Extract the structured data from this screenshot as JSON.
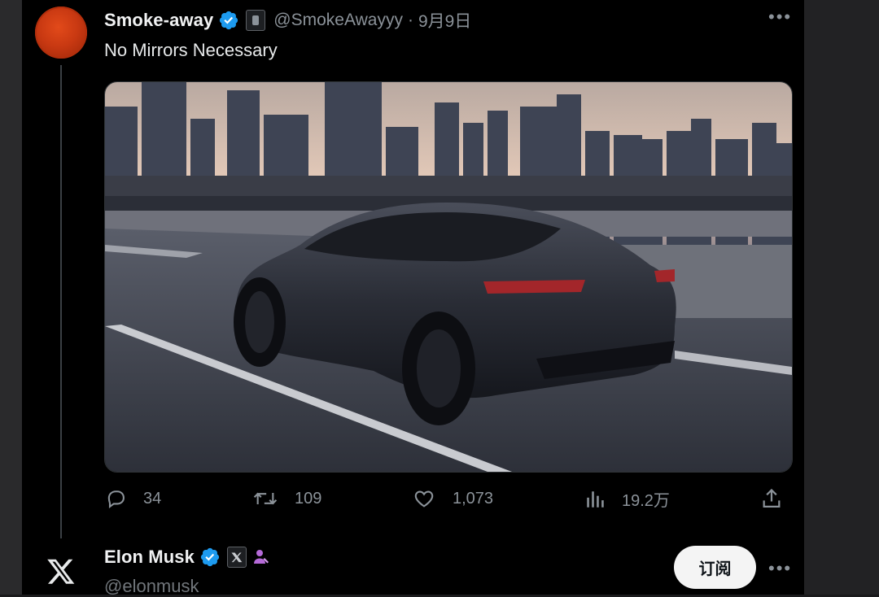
{
  "tweet": {
    "author_name": "Smoke-away",
    "handle": "@SmokeAwayyy",
    "separator": "·",
    "date": "9月9日",
    "text": "No Mirrors Necessary",
    "more_icon": "•••",
    "stats": {
      "replies": "34",
      "retweets": "109",
      "likes": "1,073",
      "views": "19.2万"
    }
  },
  "reply_author": {
    "name": "Elon Musk",
    "handle": "@elonmusk",
    "subscribe_label": "订阅",
    "more_icon": "•••"
  },
  "icons": {
    "verified": "verified-badge-icon",
    "reply": "reply-icon",
    "retweet": "retweet-icon",
    "like": "heart-icon",
    "views": "views-bar-icon",
    "share": "share-icon",
    "x_logo": "x-logo-icon"
  },
  "colors": {
    "background": "#000000",
    "verified_blue": "#1d9bf0",
    "muted_text": "#8b9299",
    "avatar_orange": "#d4431a"
  }
}
